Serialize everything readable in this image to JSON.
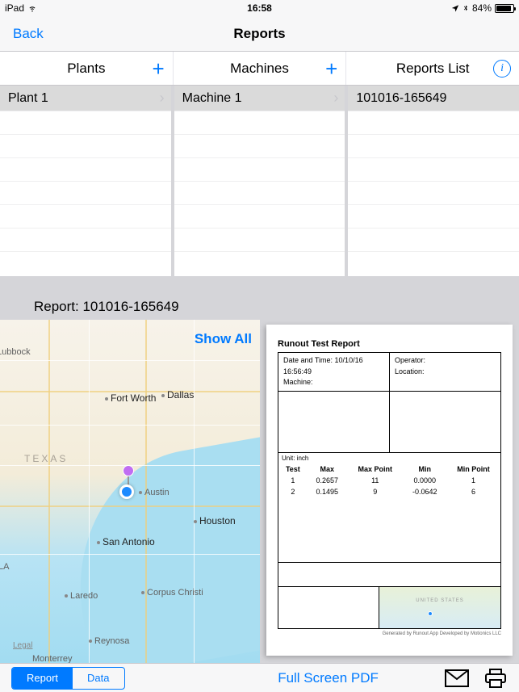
{
  "status": {
    "device": "iPad",
    "time": "16:58",
    "battery_pct": "84%"
  },
  "nav": {
    "back": "Back",
    "title": "Reports"
  },
  "columns": {
    "plants": {
      "header": "Plants",
      "items": [
        "Plant 1"
      ]
    },
    "machines": {
      "header": "Machines",
      "items": [
        "Machine 1"
      ]
    },
    "reports": {
      "header": "Reports List",
      "items": [
        "101016-165649"
      ]
    }
  },
  "report_header": "Report: 101016-165649",
  "map": {
    "show_all": "Show All",
    "legal": "Legal",
    "state": "TEXAS",
    "cities": {
      "lubbock": "Lubbock",
      "fortworth": "Fort Worth",
      "dallas": "Dallas",
      "austin": "Austin",
      "houston": "Houston",
      "sanantonio": "San Antonio",
      "corpus": "Corpus Christi",
      "laredo": "Laredo",
      "reynosa": "Reynosa",
      "monterrey": "Monterrey",
      "la": "LA"
    }
  },
  "pdf": {
    "title": "Runout Test Report",
    "meta": {
      "datetime_label": "Date and Time:",
      "datetime": "10/10/16 16:56:49",
      "machine_label": "Machine:",
      "operator_label": "Operator:",
      "location_label": "Location:"
    },
    "unit_label": "Unit: inch",
    "table": {
      "headers": [
        "Test",
        "Max",
        "Max Point",
        "Min",
        "Min Point"
      ],
      "rows": [
        [
          "1",
          "0.2657",
          "11",
          "0.0000",
          "1"
        ],
        [
          "2",
          "0.1495",
          "9",
          "-0.0642",
          "6"
        ]
      ]
    },
    "mini_map_label": "UNITED STATES",
    "footer": "Generated by Runout App Developed by Motionics LLC"
  },
  "toolbar": {
    "seg_report": "Report",
    "seg_data": "Data",
    "fullscreen": "Full Screen PDF"
  }
}
